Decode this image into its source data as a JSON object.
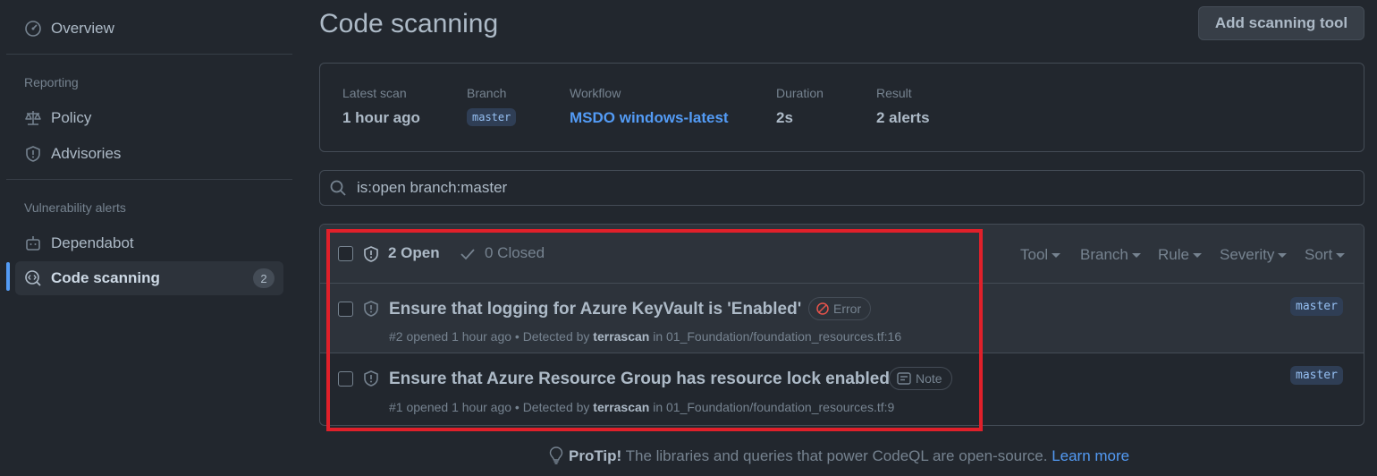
{
  "sidebar": {
    "overview": "Overview",
    "reporting_heading": "Reporting",
    "policy": "Policy",
    "advisories": "Advisories",
    "vuln_heading": "Vulnerability alerts",
    "dependabot": "Dependabot",
    "code_scanning": "Code scanning",
    "code_scanning_count": "2"
  },
  "header": {
    "title": "Code scanning",
    "add_button": "Add scanning tool"
  },
  "scan": {
    "latest_label": "Latest scan",
    "latest_value": "1 hour ago",
    "branch_label": "Branch",
    "branch_value": "master",
    "workflow_label": "Workflow",
    "workflow_value": "MSDO windows-latest",
    "duration_label": "Duration",
    "duration_value": "2s",
    "result_label": "Result",
    "result_value": "2 alerts"
  },
  "search": {
    "query": "is:open branch:master"
  },
  "alerts_header": {
    "open": "2 Open",
    "closed": "0 Closed",
    "filters": [
      "Tool",
      "Branch",
      "Rule",
      "Severity",
      "Sort"
    ]
  },
  "alerts": [
    {
      "title": "Ensure that logging for Azure KeyVault is 'Enabled'",
      "severity": "Error",
      "meta_prefix": "#2 opened 1 hour ago • Detected by ",
      "tool": "terrascan",
      "meta_in": " in 01_Foundation/foundation_resources.tf:16",
      "branch": "master"
    },
    {
      "title": "Ensure that Azure Resource Group has resource lock enabled",
      "severity": "Note",
      "meta_prefix": "#1 opened 1 hour ago • Detected by ",
      "tool": "terrascan",
      "meta_in": " in 01_Foundation/foundation_resources.tf:9",
      "branch": "master"
    }
  ],
  "protip": {
    "label": "ProTip!",
    "text": " The libraries and queries that power CodeQL are open-source. ",
    "link": "Learn more"
  },
  "colors": {
    "background": "#22272e",
    "accent": "#539bf5",
    "error": "#e5534b",
    "highlight": "#e0202a"
  }
}
